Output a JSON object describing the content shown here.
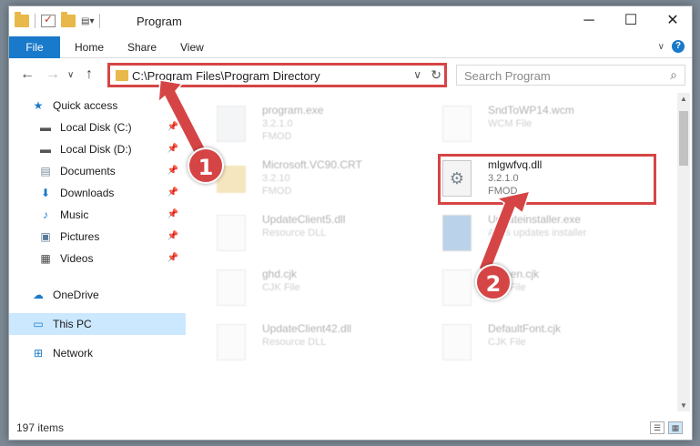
{
  "window": {
    "title": "Program"
  },
  "ribbon": {
    "tabs": [
      "File",
      "Home",
      "Share",
      "View"
    ]
  },
  "address": {
    "path": "C:\\Program Files\\Program Directory"
  },
  "search": {
    "placeholder": "Search Program"
  },
  "sidebar": {
    "items": [
      {
        "label": "Quick access",
        "icon": "star-icon"
      },
      {
        "label": "Local Disk (C:)",
        "icon": "disk-icon"
      },
      {
        "label": "Local Disk (D:)",
        "icon": "disk-icon"
      },
      {
        "label": "Documents",
        "icon": "documents-icon"
      },
      {
        "label": "Downloads",
        "icon": "download-icon"
      },
      {
        "label": "Music",
        "icon": "music-icon"
      },
      {
        "label": "Pictures",
        "icon": "pictures-icon"
      },
      {
        "label": "Videos",
        "icon": "videos-icon"
      },
      {
        "label": "OneDrive",
        "icon": "cloud-icon"
      },
      {
        "label": "This PC",
        "icon": "computer-icon"
      },
      {
        "label": "Network",
        "icon": "network-icon"
      }
    ]
  },
  "files": [
    {
      "name": "program.exe",
      "sub": "3.2.1.0",
      "sub2": "FMOD"
    },
    {
      "name": "SndToWP14.wcm",
      "sub": "WCM File",
      "sub2": ""
    },
    {
      "name": "Microsoft.VC90.CRT",
      "sub": "3.2.10",
      "sub2": "FMOD"
    },
    {
      "name": "mlgwfvq.dll",
      "sub": "3.2.1.0",
      "sub2": "FMOD"
    },
    {
      "name": "UpdateClient5.dll",
      "sub": "Resource DLL",
      "sub2": ""
    },
    {
      "name": "Updateinstaller.exe",
      "sub": "Apps updates installer",
      "sub2": ""
    },
    {
      "name": "ghd.cjk",
      "sub": "CJK File",
      "sub2": ""
    },
    {
      "name": "Screen.cjk",
      "sub": "CJK File",
      "sub2": ""
    },
    {
      "name": "UpdateClient42.dll",
      "sub": "Resource DLL",
      "sub2": ""
    },
    {
      "name": "DefaultFont.cjk",
      "sub": "CJK File",
      "sub2": ""
    }
  ],
  "status": {
    "count": "197 items"
  },
  "annotations": {
    "step1": "1",
    "step2": "2"
  },
  "colors": {
    "accent": "#1979ca",
    "highlight": "#d64545"
  }
}
